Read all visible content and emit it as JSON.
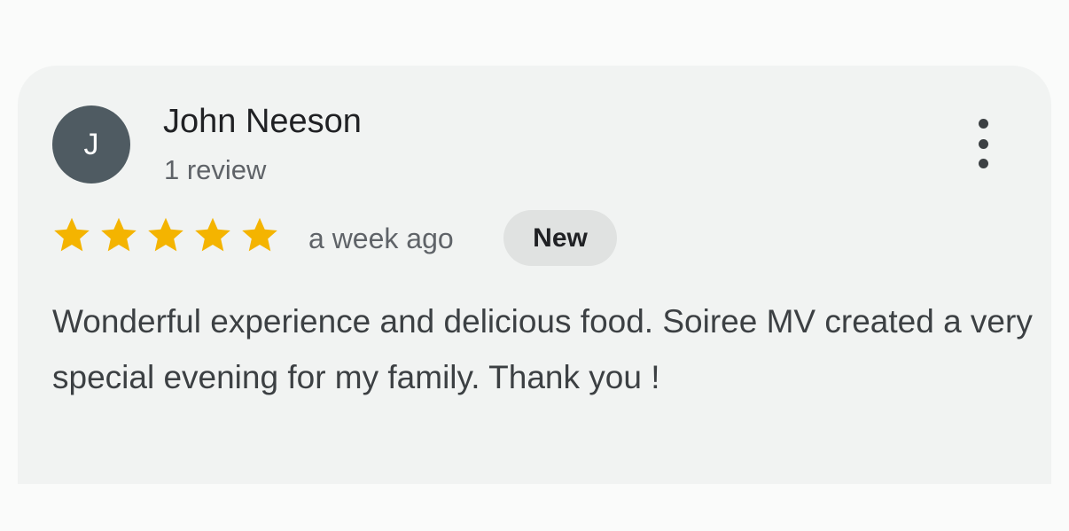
{
  "review": {
    "avatar_initial": "J",
    "reviewer_name": "John Neeson",
    "review_count": "1 review",
    "rating": 5,
    "max_rating": 5,
    "time_ago": "a week ago",
    "badge": "New",
    "text": "Wonderful experience and delicious food. Soiree MV created a very special evening for my family. Thank you !"
  },
  "icons": {
    "more": "more-vert-icon",
    "star": "star-icon"
  },
  "colors": {
    "page_background": "#fafbfa",
    "card_background": "#f1f3f2",
    "avatar_background": "#4f5b62",
    "star_filled": "#f4b400",
    "badge_background": "#e0e2e1",
    "primary_text": "#202124",
    "secondary_text": "#5f6368"
  }
}
